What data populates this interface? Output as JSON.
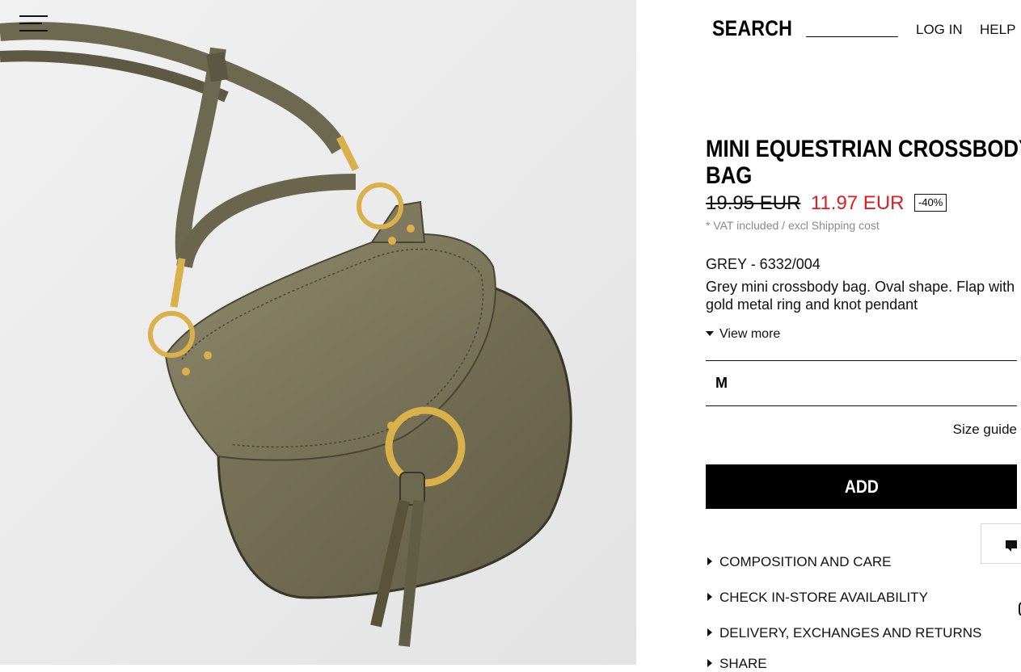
{
  "header": {
    "search_label": "SEARCH",
    "login_label": "LOG IN",
    "help_label": "HELP"
  },
  "product": {
    "title_line1": "MINI EQUESTRIAN CROSSBODY",
    "title_line2": "BAG",
    "old_price": "19.95 EUR",
    "new_price": "11.97 EUR",
    "discount": "-40%",
    "vat_note": "* VAT included / excl Shipping cost",
    "color_ref": "GREY - 6332/004",
    "description": "Grey mini crossbody bag. Oval shape. Flap with gold metal ring and knot pendant",
    "view_more": "View more",
    "selected_size": "M",
    "size_guide": "Size guide",
    "add_label": "ADD"
  },
  "accordions": [
    {
      "label": "COMPOSITION AND CARE"
    },
    {
      "label": "CHECK IN-STORE AVAILABILITY"
    },
    {
      "label": "DELIVERY, EXCHANGES AND RETURNS"
    },
    {
      "label": "SHARE"
    }
  ],
  "colors": {
    "sale_price": "#e11b22",
    "bag_leather": "#7a7458",
    "hardware_gold": "#d9b04a",
    "image_background": "#ececec"
  },
  "icons": [
    "menu-icon",
    "chat-icon",
    "view-more-caret",
    "accordion-caret"
  ]
}
